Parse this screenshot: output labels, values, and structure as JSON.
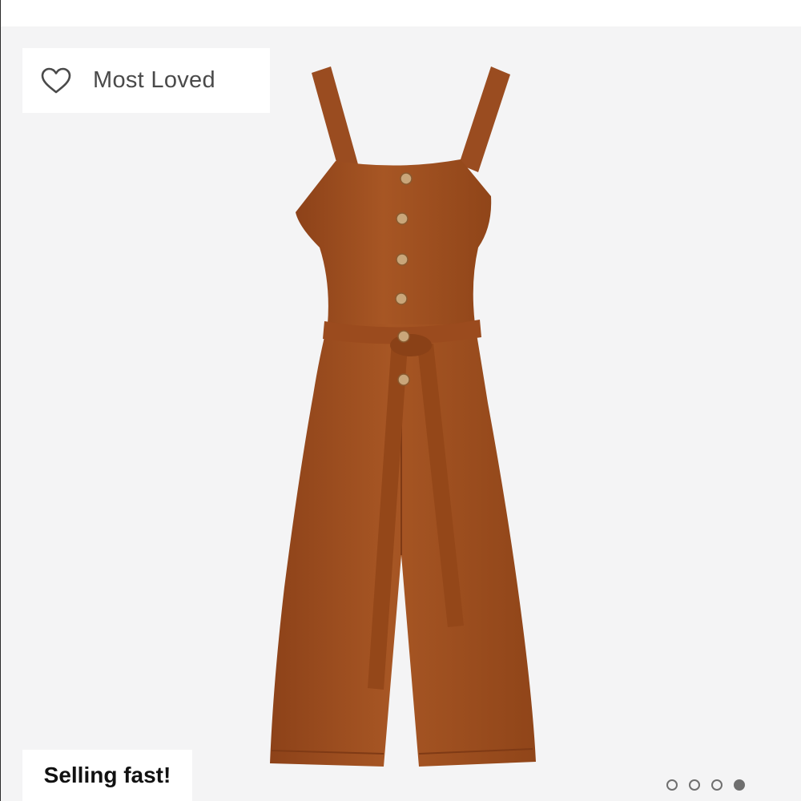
{
  "badges": {
    "most_loved_label": "Most Loved",
    "most_loved_icon": "heart-outline-icon",
    "selling_label": "Selling fast!"
  },
  "product": {
    "color": "#9e4e22"
  },
  "carousel": {
    "total": 4,
    "active_index": 3
  },
  "colors": {
    "background": "#f4f4f5",
    "badge_background": "#ffffff",
    "dot": "#6f6f6f"
  }
}
